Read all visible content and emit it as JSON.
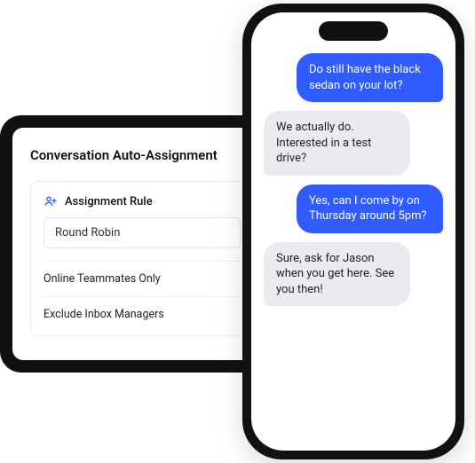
{
  "settings": {
    "title": "Conversation Auto-Assignment",
    "rule_label": "Assignment Rule",
    "rule_value": "Round Robin",
    "option_online": "Online Teammates Only",
    "option_exclude": "Exclude Inbox Managers"
  },
  "chat": {
    "messages": [
      {
        "text": "Do still have the black sedan on your lot?",
        "side": "sent"
      },
      {
        "text": "We actually do. Interested in a test drive?",
        "side": "received"
      },
      {
        "text": "Yes, can I come by on Thursday around 5pm?",
        "side": "sent"
      },
      {
        "text": "Sure, ask for Jason when you get here. See you then!",
        "side": "received"
      }
    ]
  },
  "colors": {
    "accent": "#2f5bff"
  }
}
